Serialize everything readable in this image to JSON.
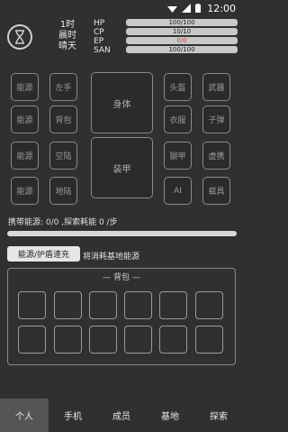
{
  "status_bar": {
    "clock": "12:00",
    "icons": [
      "wifi-icon",
      "signal-icon",
      "battery-icon"
    ]
  },
  "header": {
    "hourglass_icon": "hourglass-icon",
    "time_lines": [
      "1时",
      "晨时",
      "晴天"
    ],
    "stats": [
      {
        "label": "HP",
        "value": "100/100"
      },
      {
        "label": "CP",
        "value": "10/10"
      },
      {
        "label": "EP",
        "value": "0/0",
        "color": "#e04040"
      },
      {
        "label": "SAN",
        "value": "100/100"
      }
    ]
  },
  "equipment": {
    "left_slots": [
      "能源",
      "左手",
      "能源",
      "背包",
      "能源",
      "空陆",
      "能源",
      "地陆"
    ],
    "center_top": "身体",
    "center_bottom": "装甲",
    "right_slots": [
      "头盔",
      "武器",
      "衣服",
      "子弹",
      "腿甲",
      "虚携",
      "AI",
      "载具"
    ]
  },
  "energy_info": "携带能源: 0/0 ,探索耗能 0 /步",
  "energy_progress": 0,
  "charge_button": "能源/护盾速充",
  "charge_note": "将消耗基地能源",
  "bag": {
    "title": "— 背包 —",
    "slot_count": 12
  },
  "tabs": [
    "个人",
    "手机",
    "成员",
    "基地",
    "探索"
  ],
  "active_tab": 0,
  "colors": {
    "background": "#303030",
    "active_tab": "#555555",
    "bar": "#c8c8c8"
  }
}
